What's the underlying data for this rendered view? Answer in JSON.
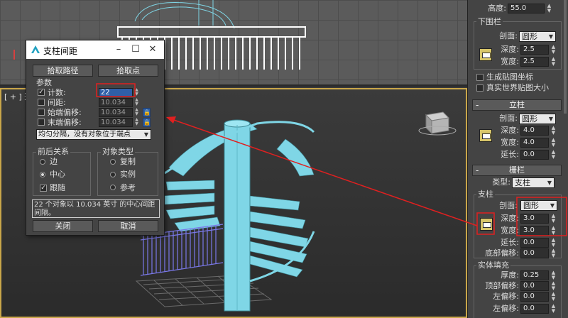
{
  "dialog": {
    "title": "支柱间距",
    "pick_path_button": "拾取路径",
    "pick_points_button": "拾取点",
    "params_title": "参数",
    "count_label": "计数:",
    "count_value": "22",
    "spacing_label": "间距:",
    "spacing_value": "10.034",
    "start_offset_label": "始端偏移:",
    "start_offset_value": "10.034",
    "end_offset_label": "末端偏移:",
    "end_offset_value": "10.034",
    "distribution_value": "均匀分隔，没有对象位于端点",
    "context_title": "前后关系",
    "ctx_edges": "边",
    "ctx_centers": "中心",
    "ctx_follow": "跟随",
    "object_type_title": "对象类型",
    "type_copy": "复制",
    "type_instance": "实例",
    "type_reference": "参考",
    "status_text": "22 个对象以 10.034 英寸 的中心间距间隔。",
    "close_button": "关闭",
    "cancel_button": "取消"
  },
  "viewport": {
    "persp_label": "[ + ] 透"
  },
  "panel": {
    "height_label": "高度:",
    "height_value": "55.0",
    "lower_rail_title": "下围栏",
    "lower_profile_label": "剖面:",
    "lower_profile_value": "圆形",
    "lower_depth_label": "深度:",
    "lower_depth_value": "2.5",
    "lower_width_label": "宽度:",
    "lower_width_value": "2.5",
    "gen_map_coords": "生成贴图坐标",
    "real_world_map": "真实世界贴图大小",
    "posts_rollout": "立柱",
    "posts_profile_label": "剖面:",
    "posts_profile_value": "圆形",
    "posts_depth_label": "深度:",
    "posts_depth_value": "4.0",
    "posts_width_label": "宽度:",
    "posts_width_value": "4.0",
    "posts_ext_label": "延长:",
    "posts_ext_value": "0.0",
    "fencing_rollout": "栅栏",
    "fencing_type_label": "类型:",
    "fencing_type_value": "支柱",
    "support_title": "支柱",
    "support_profile_label": "剖面:",
    "support_profile_value": "圆形",
    "support_depth_label": "深度:",
    "support_depth_value": "3.0",
    "support_width_label": "宽度:",
    "support_width_value": "3.0",
    "support_ext_label": "延长:",
    "support_ext_value": "0.0",
    "bottom_offset_label": "底部偏移:",
    "bottom_offset_value": "0.0",
    "solid_fill_title": "实体填充",
    "thickness_label": "厚度:",
    "thickness_value": "0.25",
    "top_offset_label": "顶部偏移:",
    "top_offset_value": "0.0",
    "left_offset_label": "左偏移:",
    "left_offset_value": "0.0",
    "left_offset2_label": "左偏移:",
    "left_offset2_value": "0.0"
  },
  "colors": {
    "highlight_red": "#e02020",
    "stair_cyan": "#7fd6e6",
    "rail_blue": "#7a78e8",
    "active_border": "#c9a64a"
  }
}
